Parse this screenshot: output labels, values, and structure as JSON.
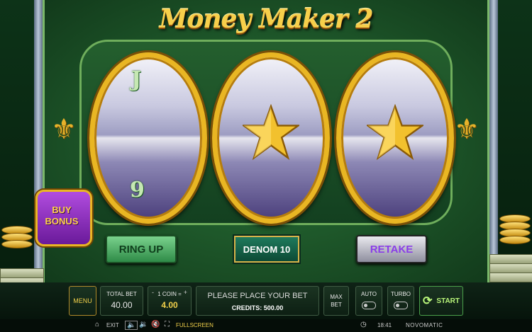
{
  "game": {
    "title": "Money Maker 2"
  },
  "reels": [
    {
      "symbols": [
        {
          "icon": "scroll-icon",
          "glyph": "J"
        },
        {
          "icon": "scroll-icon",
          "glyph": "9"
        }
      ]
    },
    {
      "symbols": [
        {
          "icon": "star-icon"
        }
      ]
    },
    {
      "symbols": [
        {
          "icon": "star-icon"
        }
      ]
    }
  ],
  "buttons": {
    "buy_bonus": "BUY\nBONUS",
    "ring_up": "RING UP",
    "denom": "DENOM 10",
    "retake": "RETAKE"
  },
  "controls": {
    "menu": "MENU",
    "total_bet_label": "TOTAL BET",
    "total_bet_value": "40.00",
    "coin_label": "1 COIN =",
    "coin_value": "4.00",
    "minus": "-",
    "plus": "+",
    "message": "PLEASE PLACE YOUR BET",
    "credits": "CREDITS: 500.00",
    "max_bet": "MAX\nBET",
    "auto": "AUTO",
    "turbo": "TURBO",
    "start": "START"
  },
  "statusbar": {
    "exit": "EXIT",
    "fullscreen": "FULLSCREEN",
    "time": "18:41",
    "brand": "NOVOMATIC"
  },
  "colors": {
    "gold": "#f0cf4a",
    "green": "#2f8b48",
    "purple": "#8a3ee8"
  }
}
